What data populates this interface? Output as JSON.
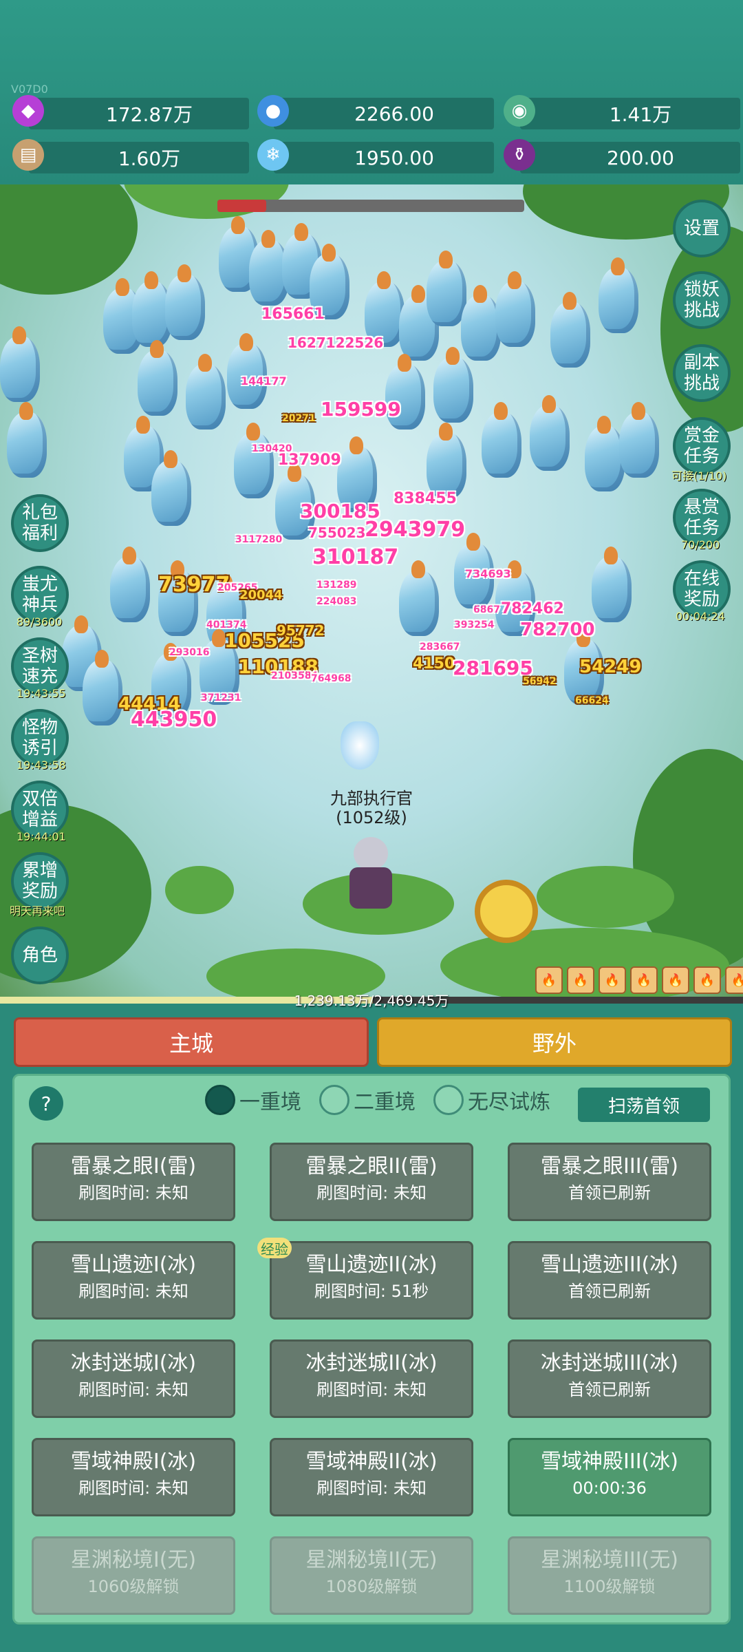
{
  "version": "V07D0",
  "resources": [
    {
      "icon": "diamond-icon",
      "value": "172.87万"
    },
    {
      "icon": "blue-gem-icon",
      "value": "2266.00"
    },
    {
      "icon": "orb-icon",
      "value": "1.41万"
    },
    {
      "icon": "scroll-icon",
      "value": "1.60万"
    },
    {
      "icon": "ice-crystal-icon",
      "value": "1950.00"
    },
    {
      "icon": "potion-icon",
      "value": "200.00"
    }
  ],
  "boss_hp": 0.16,
  "right_buttons": [
    {
      "label": "设置",
      "sub": ""
    },
    {
      "label": "锁妖挑战",
      "sub": ""
    },
    {
      "label": "副本挑战",
      "sub": ""
    },
    {
      "label": "赏金任务",
      "sub": "可接(1/10)"
    },
    {
      "label": "悬赏任务",
      "sub": "70/200"
    },
    {
      "label": "在线奖励",
      "sub": "00:04:24"
    }
  ],
  "left_buttons": [
    {
      "label": "礼包福利",
      "sub": ""
    },
    {
      "label": "蚩尤神兵",
      "sub": "89/3600"
    },
    {
      "label": "圣树速充",
      "sub": "19:43:55"
    },
    {
      "label": "怪物诱引",
      "sub": "19:43:58"
    },
    {
      "label": "双倍增益",
      "sub": "19:44:01"
    },
    {
      "label": "累增奖励",
      "sub": "明天再来吧"
    },
    {
      "label": "角色",
      "sub": ""
    }
  ],
  "damage_numbers": [
    "165661",
    "1627122526",
    "144177",
    "159599",
    "20271",
    "130420",
    "137909",
    "838455",
    "300185",
    "755023",
    "2943979",
    "310187",
    "3117280",
    "734693",
    "73977",
    "205265",
    "20044",
    "131289",
    "224083",
    "401374",
    "105525",
    "95772",
    "293016",
    "110188",
    "2103584",
    "764968",
    "44414",
    "443950",
    "371231",
    "6867",
    "782462",
    "393254",
    "782700",
    "283667",
    "4150",
    "281695",
    "54249",
    "56942",
    "66624"
  ],
  "hero": {
    "name": "九部执行官",
    "level": "(1052级)"
  },
  "xp": {
    "text": "1,239.13万/2,469.45万",
    "ratio": 0.502
  },
  "skills": [
    "🔥",
    "🔥",
    "🔥",
    "🔥",
    "🔥",
    "🔥",
    "🔥"
  ],
  "tabs": {
    "main": "主城",
    "wild": "野外"
  },
  "help": "?",
  "realms": [
    {
      "label": "一重境",
      "selected": true
    },
    {
      "label": "二重境",
      "selected": false
    },
    {
      "label": "无尽试炼",
      "selected": false
    }
  ],
  "sweep_label": "扫荡首领",
  "exp_badge": "经验",
  "maps": [
    {
      "name": "雷暴之眼I(雷)",
      "info": "刷图时间: 未知",
      "state": "normal"
    },
    {
      "name": "雷暴之眼II(雷)",
      "info": "刷图时间: 未知",
      "state": "normal"
    },
    {
      "name": "雷暴之眼III(雷)",
      "info": "首领已刷新",
      "state": "normal"
    },
    {
      "name": "雪山遗迹I(冰)",
      "info": "刷图时间: 未知",
      "state": "normal"
    },
    {
      "name": "雪山遗迹II(冰)",
      "info": "刷图时间: 51秒",
      "state": "normal"
    },
    {
      "name": "雪山遗迹III(冰)",
      "info": "首领已刷新",
      "state": "normal"
    },
    {
      "name": "冰封迷城I(冰)",
      "info": "刷图时间: 未知",
      "state": "normal"
    },
    {
      "name": "冰封迷城II(冰)",
      "info": "刷图时间: 未知",
      "state": "normal"
    },
    {
      "name": "冰封迷城III(冰)",
      "info": "首领已刷新",
      "state": "normal"
    },
    {
      "name": "雪域神殿I(冰)",
      "info": "刷图时间: 未知",
      "state": "normal"
    },
    {
      "name": "雪域神殿II(冰)",
      "info": "刷图时间: 未知",
      "state": "normal"
    },
    {
      "name": "雪域神殿III(冰)",
      "info": "00:00:36",
      "state": "active"
    },
    {
      "name": "星渊秘境I(无)",
      "info": "1060级解锁",
      "state": "locked"
    },
    {
      "name": "星渊秘境II(无)",
      "info": "1080级解锁",
      "state": "locked"
    },
    {
      "name": "星渊秘境III(无)",
      "info": "1100级解锁",
      "state": "locked"
    }
  ]
}
